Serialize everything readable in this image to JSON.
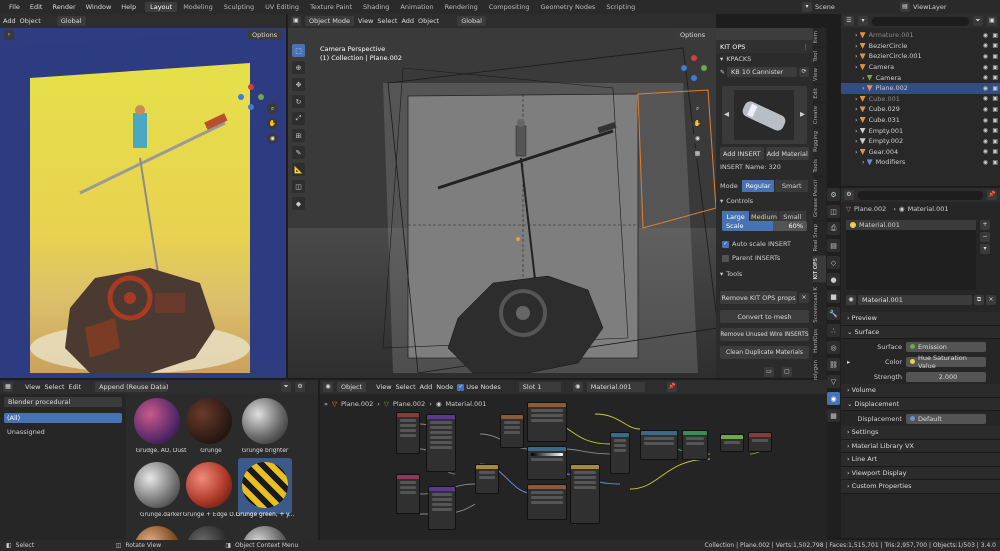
{
  "topbar": {
    "menus": [
      "File",
      "Edit",
      "Render",
      "Window",
      "Help"
    ],
    "workspaces": [
      "Layout",
      "Modeling",
      "Sculpting",
      "UV Editing",
      "Texture Paint",
      "Shading",
      "Animation",
      "Rendering",
      "Compositing",
      "Geometry Nodes",
      "Scripting"
    ],
    "active_workspace": "Layout",
    "scene": "Scene",
    "view_layer": "ViewLayer"
  },
  "left_viewport": {
    "header": [
      "Add",
      "Object"
    ],
    "orientation": "Global",
    "options": "Options"
  },
  "main_viewport": {
    "mode": "Object Mode",
    "menus": [
      "View",
      "Select",
      "Add",
      "Object"
    ],
    "orientation": "Global",
    "options": "Options",
    "camera_title": "Camera Perspective",
    "collection_info": "(1) Collection | Plane.002"
  },
  "kitops": {
    "title": "KIT OPS",
    "kpacks_label": "KPACKS",
    "kpack": "KB 10 Cannister",
    "add_insert": "Add INSERT",
    "add_material": "Add Material",
    "insert_name": "INSERT Name: 320",
    "mode_label": "Mode",
    "mode_regular": "Regular",
    "mode_smart": "Smart",
    "controls": "Controls",
    "size_large": "Large",
    "size_medium": "Medium",
    "size_small": "Small",
    "scale_label": "Scale",
    "scale_value": "60%",
    "auto_scale": "Auto scale INSERT",
    "parent_inserts": "Parent INSERTs",
    "tools": "Tools",
    "remove_props": "Remove KIT OPS props",
    "convert_mesh": "Convert to mesh",
    "remove_wire": "Remove Unused Wire INSERTS",
    "clean_materials": "Clean Duplicate Materials",
    "tabs": [
      "Item",
      "Tool",
      "View",
      "Edit",
      "Create",
      "Rigging",
      "Tools",
      "Grease Pencil",
      "Real Snap",
      "KIT OPS",
      "Screencast K",
      "HardOps",
      "polygon"
    ]
  },
  "outliner": {
    "rows": [
      {
        "name": "Armature.001",
        "indent": 2,
        "color": "#e0934a",
        "dim": true
      },
      {
        "name": "BezierCircle",
        "indent": 2,
        "color": "#e0934a"
      },
      {
        "name": "BezierCircle.001",
        "indent": 2,
        "color": "#e0934a"
      },
      {
        "name": "Camera",
        "indent": 2,
        "color": "#e0934a"
      },
      {
        "name": "Camera",
        "indent": 3,
        "color": "#6ea84f"
      },
      {
        "name": "Plane.002",
        "indent": 3,
        "color": "#e0934a",
        "selected": true
      },
      {
        "name": "Cube.001",
        "indent": 2,
        "color": "#e0934a",
        "dim": true
      },
      {
        "name": "Cube.029",
        "indent": 2,
        "color": "#e0934a"
      },
      {
        "name": "Cube.031",
        "indent": 2,
        "color": "#e0934a"
      },
      {
        "name": "Empty.001",
        "indent": 2,
        "color": "#cfcfcf"
      },
      {
        "name": "Empty.002",
        "indent": 2,
        "color": "#cfcfcf"
      },
      {
        "name": "Gear.004",
        "indent": 2,
        "color": "#e0934a"
      },
      {
        "name": "Modifiers",
        "indent": 3,
        "color": "#6a8fd1"
      }
    ]
  },
  "properties": {
    "object_name": "Plane.002",
    "material_slot": "Material.001",
    "slot_item": "Material.001",
    "material_name": "Material.001",
    "sections": {
      "preview": "Preview",
      "surface": "Surface",
      "surface_label": "Surface",
      "surface_value": "Emission",
      "color_label": "Color",
      "color_value": "Hue Saturation Value",
      "strength_label": "Strength",
      "strength_value": "2.000",
      "volume": "Volume",
      "displacement": "Displacement",
      "displacement_label": "Displacement",
      "displacement_value": "Default",
      "settings": "Settings",
      "matlib": "Material Library VX",
      "lineart": "Line Art",
      "viewport_display": "Viewport Display",
      "custom_props": "Custom Properties"
    }
  },
  "asset_browser": {
    "menus": [
      "View",
      "Select",
      "Edit"
    ],
    "import_mode": "Append (Reuse Data)",
    "library": "Blender procedural",
    "catalog_all": "(All)",
    "catalog_unassigned": "Unassigned",
    "assets": [
      "Grudge, AO, Dust",
      "Grunge",
      "Grunge brighter",
      "Grunge.darker",
      "Grunge + Edge D...",
      "Grunge green, + y..."
    ]
  },
  "node_editor": {
    "type": "Object",
    "menus": [
      "View",
      "Select",
      "Add",
      "Node"
    ],
    "use_nodes": "Use Nodes",
    "slot": "Slot 1",
    "material": "Material.001",
    "breadcrumb": [
      "Plane.002",
      "Plane.002",
      "Material.001"
    ]
  },
  "statusbar": {
    "left": [
      "Select",
      "Rotate View",
      "Object Context Menu"
    ],
    "right": "Collection | Plane.002 | Verts:1,502,798 | Faces:1,515,701 | Tris:2,957,700 | Objects:1/503 | 3.4.0"
  }
}
